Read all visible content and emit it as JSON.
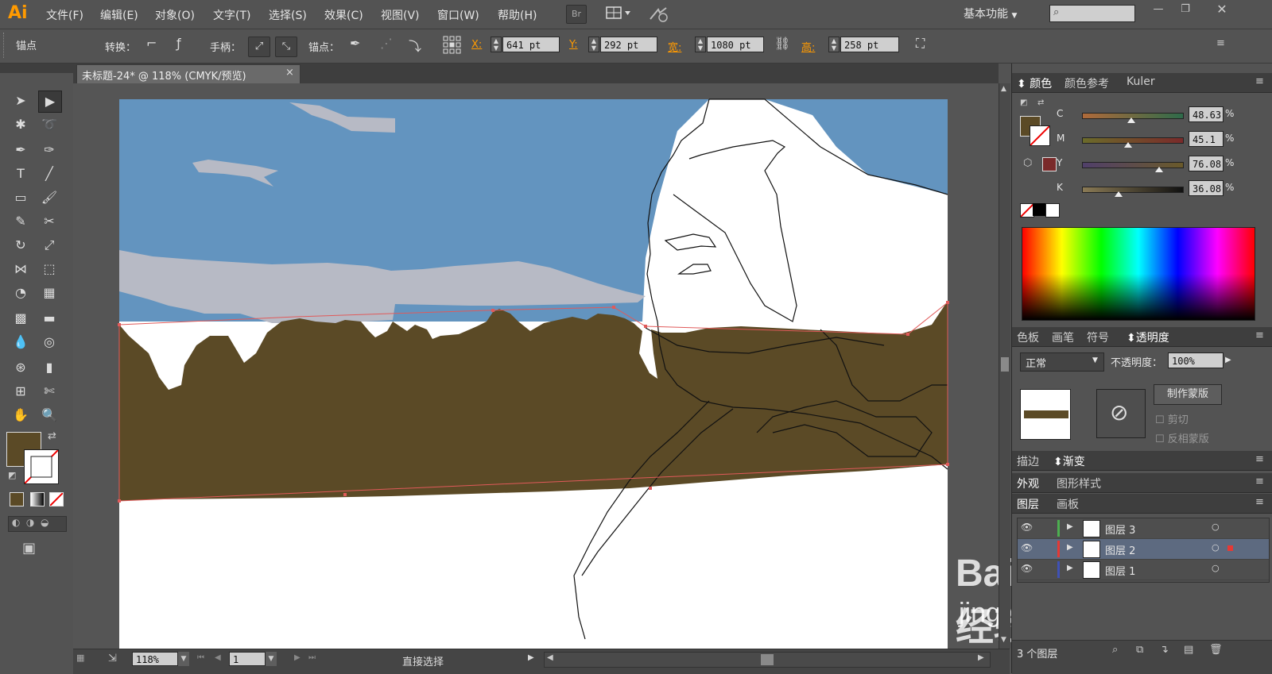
{
  "app": {
    "logo": "Ai",
    "workspace": "基本功能"
  },
  "menu": [
    "文件(F)",
    "编辑(E)",
    "对象(O)",
    "文字(T)",
    "选择(S)",
    "效果(C)",
    "视图(V)",
    "窗口(W)",
    "帮助(H)"
  ],
  "menu_extra": {
    "br": "Br"
  },
  "control": {
    "tool_label": "锚点",
    "convert_label": "转换：",
    "handle_label": "手柄：",
    "anchor_label": "锚点：",
    "x_label": "X:",
    "x_value": "641 pt",
    "y_label": "Y:",
    "y_value": "292 pt",
    "w_label": "宽:",
    "w_value": "1080 pt",
    "h_label": "高:",
    "h_value": "258 pt"
  },
  "document": {
    "tab_title": "未标题-24* @ 118% (CMYK/预览)",
    "close": "×"
  },
  "color_panel": {
    "tabs": [
      "颜色",
      "颜色参考",
      "Kuler"
    ],
    "channels": [
      {
        "label": "C",
        "value": "48.63",
        "fraction": 0.4863
      },
      {
        "label": "M",
        "value": "45.1",
        "fraction": 0.451
      },
      {
        "label": "Y",
        "value": "76.08",
        "fraction": 0.7608
      },
      {
        "label": "K",
        "value": "36.08",
        "fraction": 0.3608
      }
    ],
    "fill_color": "#5b4a26",
    "stroke_color": "#7a2a2a"
  },
  "transparency_panel": {
    "tabs": [
      "色板",
      "画笔",
      "符号",
      "透明度"
    ],
    "blend_mode": "正常",
    "opacity_label": "不透明度：",
    "opacity_value": "100%",
    "make_mask": "制作蒙版",
    "clip": "剪切",
    "invert_mask": "反相蒙版"
  },
  "stroke_panel": {
    "tabs": [
      "描边",
      "渐变"
    ]
  },
  "appearance_panel": {
    "tabs": [
      "外观",
      "图形样式"
    ]
  },
  "layers_panel": {
    "tabs": [
      "图层",
      "画板"
    ],
    "layers": [
      {
        "name": "图层 3",
        "color": "#4caf50"
      },
      {
        "name": "图层 2",
        "color": "#e53935"
      },
      {
        "name": "图层 1",
        "color": "#3f51b5"
      }
    ],
    "count": "3 个图层"
  },
  "status": {
    "zoom": "118%",
    "artboard": "1",
    "tool_name": "直接选择"
  },
  "watermark": {
    "brand": "Baidu经验",
    "url": "jingyan.baidu.com"
  },
  "colors": {
    "sky": "#6394bf",
    "cloud": "#b7bac5",
    "ground": "#5b4a26",
    "accent": "#ff9a00"
  }
}
